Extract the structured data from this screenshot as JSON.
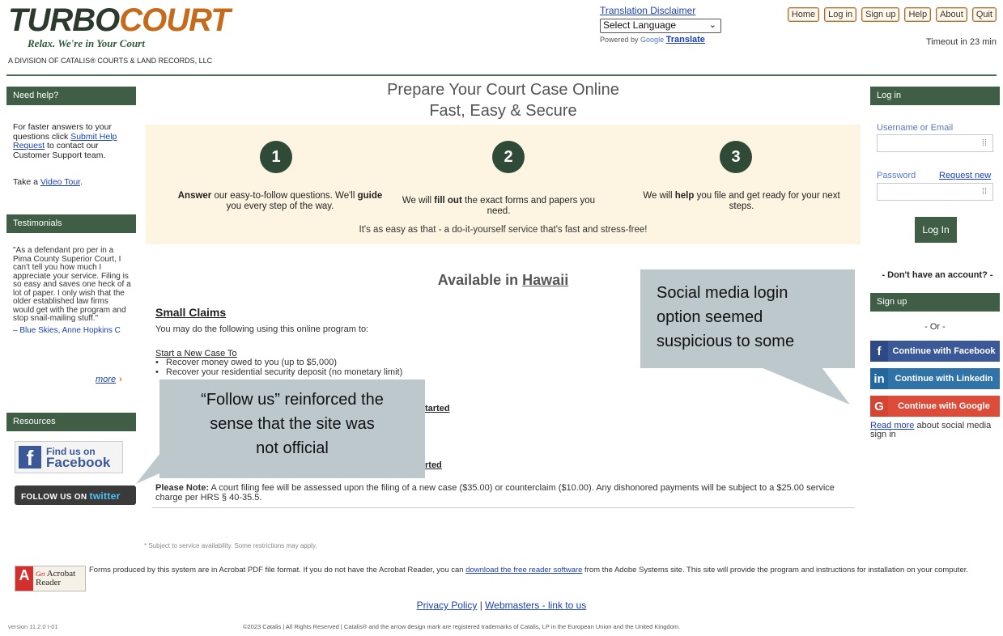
{
  "header": {
    "logo_turbo": "TURBO",
    "logo_court": "COURT",
    "logo_tagline": "Relax. We're in Your Court",
    "logo_division": "A DIVISION OF CATALIS® COURTS & LAND RECORDS, LLC",
    "translation_disclaimer": "Translation Disclaimer",
    "language_select": "Select Language",
    "powered_by": "Powered by",
    "google": "Google",
    "translate": "Translate",
    "nav": [
      "Home",
      "Log in",
      "Sign up",
      "Help",
      "About",
      "Quit"
    ],
    "timeout": "Timeout in 23 min"
  },
  "left": {
    "need_help_title": "Need help?",
    "help_text_1": "For faster answers to your questions click",
    "help_link": "Submit Help Request",
    "help_text_2": "to contact our Customer Support team.",
    "tour_prefix": "Take a",
    "tour_link": "Video Tour",
    "testimonials_title": "Testimonials",
    "testimonial_quote": "\"As a defendant pro per in a Pima County Superior Court, I can't tell you how much I appreciate your service. Filing is so easy and saves one heck of a lot of paper. I only wish that the older established law firms would get with the program and stop snail-mailing stuff.\"",
    "testimonial_author": "– Blue Skies, Anne Hopkins C",
    "more": "more",
    "resources_title": "Resources",
    "fb_find": "Find us on",
    "fb_facebook": "Facebook",
    "tw_follow": "FOLLOW US ON",
    "tw_twitter": "twitter"
  },
  "center": {
    "title_1": "Prepare Your Court Case Online",
    "title_2": "Fast, Easy & Secure",
    "steps": [
      {
        "num": "1",
        "text_pre": "",
        "bold1": "Answer",
        "text_mid": " our easy-to-follow questions. We'll ",
        "bold2": "guide",
        "text_post": " you every step of the way."
      },
      {
        "num": "2",
        "text_pre": "We will ",
        "bold1": "fill out",
        "text_mid": " the exact forms and papers you need.",
        "bold2": "",
        "text_post": ""
      },
      {
        "num": "3",
        "text_pre": "We will ",
        "bold1": "help",
        "text_mid": " you file and get ready for your next steps.",
        "bold2": "",
        "text_post": ""
      }
    ],
    "easy_text": "It's as easy as that - a do-it-yourself service that's fast and stress-free!",
    "available_prefix": "Available in",
    "available_state": "Hawaii",
    "section_title": "Small Claims",
    "section_intro": "You may do the following using this online program to:",
    "start_new": "Start a New Case To",
    "bullets": [
      "Recover money owed to you (up to $5,000)",
      "Recover your residential security deposit (no monetary limit)"
    ],
    "get_started_1": "tarted",
    "get_started_2": "rted",
    "note_bold": "Please Note:",
    "note_text": " A court filing fee will be assessed upon the filing of a new case ($35.00) or counterclaim ($10.00). Any dishonored payments will be subject to a $25.00 service charge per HRS § 40-35.5."
  },
  "callouts": {
    "follow_us_1": "“Follow us” reinforced the",
    "follow_us_2": "sense that the site was",
    "follow_us_3": "not official",
    "social_1": "Social media login",
    "social_2": "option seemed",
    "social_3": "suspicious to some"
  },
  "right": {
    "login_title": "Log in",
    "username_label": "Username or Email",
    "password_label": "Password",
    "request_new": "Request new",
    "login_button": "Log In",
    "no_account": "- Don't have an account? -",
    "signup_title": "Sign up",
    "or": "- Or -",
    "fb_button": "Continue with Facebook",
    "li_button": "Continue with Linkedin",
    "google_button": "Continue with Google",
    "read_more_link": "Read more",
    "read_more_text": " about social media sign in"
  },
  "footer": {
    "subject_note": "* Subject to service availability. Some restrictions may apply.",
    "acro_get": "Get",
    "acro_name_1": "Acrobat",
    "acro_name_2": "Reader",
    "acro_pre": "Forms produced by this system are in Acrobat PDF file format. If you do not have the Acrobat Reader, you can ",
    "acro_link": "download the free reader software",
    "acro_post": " from the Adobe Systems site. This site will provide the program and instructions for installation on your computer.",
    "privacy": "Privacy Policy",
    "webmasters": "Webmasters - link to us",
    "version": "version 11.2.0  I-01",
    "copyright": "©2023 Catalis | All Rights Reserved | Catalis® and the arrow design mark are registered trademarks of Catalis, LP in the European Union and the United Kingdom."
  }
}
